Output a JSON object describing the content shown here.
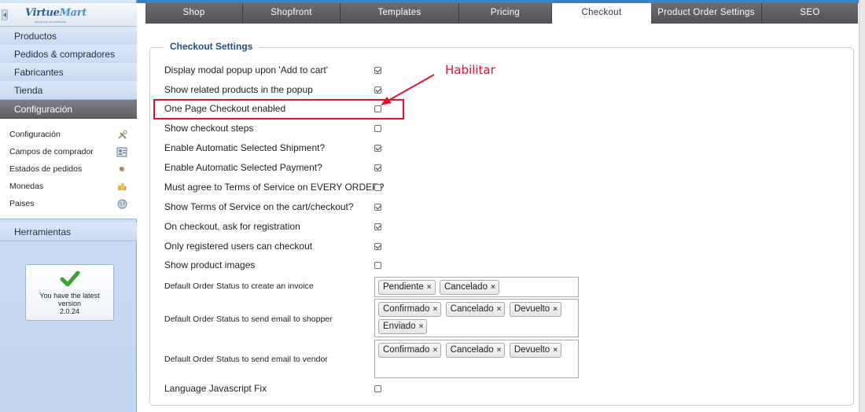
{
  "logo": {
    "name": "VirtueMart",
    "name_part1": "Virtue",
    "name_part2": "Mart",
    "tagline": "shopping cart software"
  },
  "sidebar": {
    "menu": [
      {
        "label": "Productos"
      },
      {
        "label": "Pedidos & compradores"
      },
      {
        "label": "Fabricantes"
      },
      {
        "label": "Tienda"
      },
      {
        "label": "Configuración",
        "active": true
      }
    ],
    "submenu": [
      {
        "label": "Configuración",
        "icon": "tools-icon"
      },
      {
        "label": "Campos de comprador",
        "icon": "user-card-icon"
      },
      {
        "label": "Estados de pedidos",
        "icon": "status-icon"
      },
      {
        "label": "Monedas",
        "icon": "coins-icon"
      },
      {
        "label": "Paises",
        "icon": "globe-icon"
      }
    ],
    "tools_label": "Herramientas",
    "version": {
      "text": "You have the latest version",
      "number": "2.0.24"
    }
  },
  "tabs": [
    {
      "label": "Shop"
    },
    {
      "label": "Shopfront"
    },
    {
      "label": "Templates"
    },
    {
      "label": "Pricing"
    },
    {
      "label": "Checkout",
      "active": true
    },
    {
      "label": "Product Order Settings"
    },
    {
      "label": "SEO"
    }
  ],
  "checkout": {
    "legend": "Checkout Settings",
    "settings": [
      {
        "label": "Display modal popup upon 'Add to cart'",
        "checked": true
      },
      {
        "label": "Show related products in the popup",
        "checked": true
      },
      {
        "label": "One Page Checkout enabled",
        "checked": false
      },
      {
        "label": "Show checkout steps",
        "checked": false
      },
      {
        "label": "Enable Automatic Selected Shipment?",
        "checked": true
      },
      {
        "label": "Enable Automatic Selected Payment?",
        "checked": true
      },
      {
        "label": "Must agree to Terms of Service on EVERY ORDER?",
        "checked": false
      },
      {
        "label": "Show Terms of Service on the cart/checkout?",
        "checked": true
      },
      {
        "label": "On checkout, ask for registration",
        "checked": true
      },
      {
        "label": "Only registered users can checkout",
        "checked": true
      },
      {
        "label": "Show product images",
        "checked": false
      }
    ],
    "status_fields": [
      {
        "label": "Default Order Status to create an invoice",
        "values": [
          "Pendiente",
          "Cancelado"
        ]
      },
      {
        "label": "Default Order Status to send email to shopper",
        "values": [
          "Confirmado",
          "Cancelado",
          "Devuelto",
          "Enviado"
        ]
      },
      {
        "label": "Default Order Status to send email to vendor",
        "values": [
          "Confirmado",
          "Cancelado",
          "Devuelto"
        ]
      }
    ],
    "js_fix": {
      "label": "Language Javascript Fix",
      "checked": false
    }
  },
  "annotation": {
    "text": "Habilitar",
    "color": "#e0112b"
  },
  "chip_remove_glyph": "×"
}
